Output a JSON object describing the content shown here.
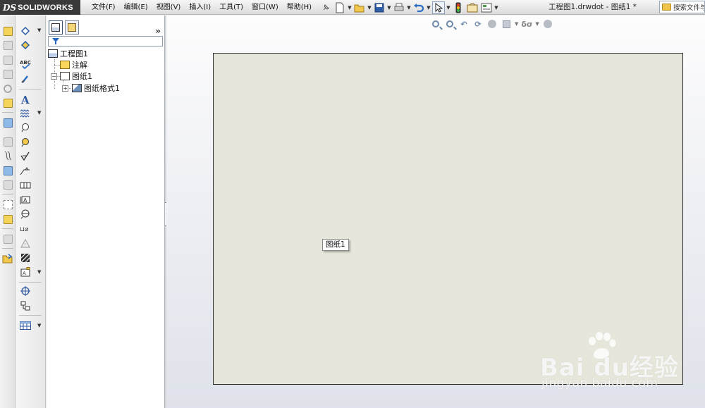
{
  "app": {
    "ds_mark": "DS",
    "brand": "SOLIDWORKS",
    "document_title": "工程图1.drwdot - 图纸1 *"
  },
  "menu": [
    {
      "label": "文件(F)"
    },
    {
      "label": "编辑(E)"
    },
    {
      "label": "视图(V)"
    },
    {
      "label": "插入(I)"
    },
    {
      "label": "工具(T)"
    },
    {
      "label": "窗口(W)"
    },
    {
      "label": "帮助(H)"
    }
  ],
  "search": {
    "label": "搜索文件与"
  },
  "feature_tree": {
    "root": "工程图1",
    "items": [
      {
        "label": "注解",
        "icon": "annotation-icon"
      },
      {
        "label": "图纸1",
        "icon": "sheet-icon"
      },
      {
        "label": "图纸格式1",
        "icon": "sheet-format-icon"
      }
    ],
    "expand_glyph": "»"
  },
  "sheet": {
    "tooltip": "图纸1"
  },
  "watermark": {
    "logo": "Bai du经验",
    "url": "jingyan.baidu.com"
  },
  "colors": {
    "sheet_background": "#e7e6da",
    "logo_bar": "#3a3a3a"
  }
}
